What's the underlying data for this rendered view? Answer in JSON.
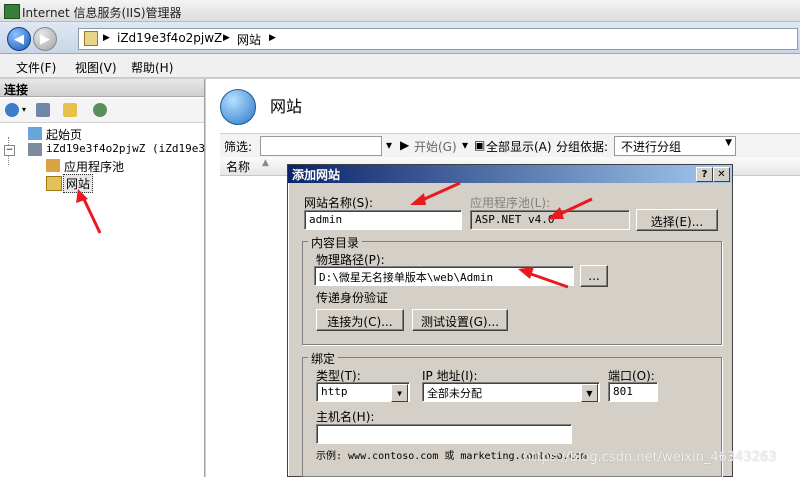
{
  "window": {
    "title": "Internet 信息服务(IIS)管理器"
  },
  "address": {
    "segments": [
      "iZd19e3f4o2pjwZ",
      "网站"
    ]
  },
  "menu": {
    "items": [
      "文件(F)",
      "视图(V)",
      "帮助(H)"
    ]
  },
  "connections": {
    "header": "连接",
    "tree": {
      "start_page": "起始页",
      "server": "iZd19e3f4o2pjwZ (iZd19e3f4",
      "app_pools": "应用程序池",
      "sites": "网站"
    }
  },
  "main": {
    "title": "网站",
    "filter_label": "筛选:",
    "start_btn": "开始(G)",
    "show_all": "全部显示(A)",
    "groupby_label": "分组依据:",
    "groupby_value": "不进行分组",
    "col_name": "名称"
  },
  "dialog": {
    "title": "添加网站",
    "help_btn": "?",
    "close_btn": "✕",
    "site_name_label": "网站名称(S):",
    "site_name_value": "admin",
    "app_pool_label": "应用程序池(L):",
    "app_pool_value": "ASP.NET v4.0",
    "select_btn": "选择(E)...",
    "content_group": "内容目录",
    "physical_path_label": "物理路径(P):",
    "physical_path_value": "D:\\微星无名接单版本\\web\\Admin",
    "browse_btn": "...",
    "passthrough_label": "传递身份验证",
    "connect_as_btn": "连接为(C)...",
    "test_settings_btn": "测试设置(G)...",
    "binding_group": "绑定",
    "type_label": "类型(T):",
    "type_value": "http",
    "ip_label": "IP 地址(I):",
    "ip_value": "全部未分配",
    "port_label": "端口(O):",
    "port_value": "801",
    "hostname_label": "主机名(H):",
    "hostname_value": "",
    "example_text": "示例: www.contoso.com 或 marketing.contoso.com"
  },
  "watermark": "https://blog.csdn.net/weixin_46343263",
  "colors": {
    "annotation_arrow": "#e8191f",
    "dialog_title": "#0a246a"
  }
}
